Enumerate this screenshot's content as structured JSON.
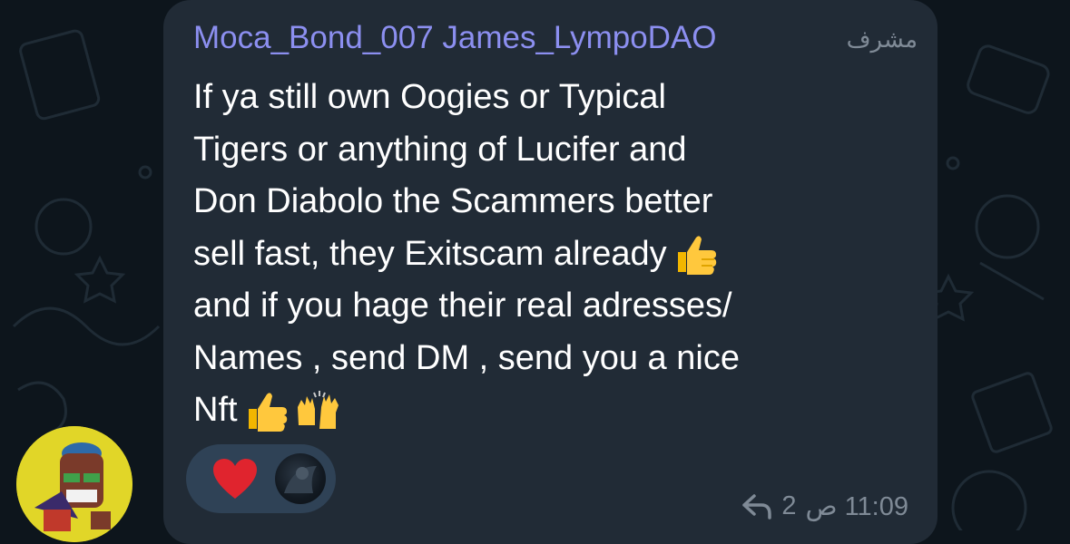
{
  "message": {
    "sender": "Moca_Bond_007 James_LympoDAO",
    "role_badge": "مشرف",
    "lines": [
      "If ya still own Oogies or Typical",
      "Tigers or anything of Lucifer and",
      "Don Diabolo the Scammers better",
      "sell fast, they Exitscam already",
      "and if you hage their real adresses/",
      "Names , send DM , send you a nice",
      "Nft"
    ],
    "reply_count": "2",
    "time": "11:09 ص"
  },
  "reactions": [
    {
      "icon": "heart-icon"
    }
  ],
  "colors": {
    "background": "#0d151c",
    "bubble": "#212b36",
    "sender_name": "#8c8ff0",
    "meta_text": "#7f8a96",
    "reaction_pill": "#2f4256",
    "heart": "#e0242e",
    "avatar_bg": "#e1d628"
  }
}
